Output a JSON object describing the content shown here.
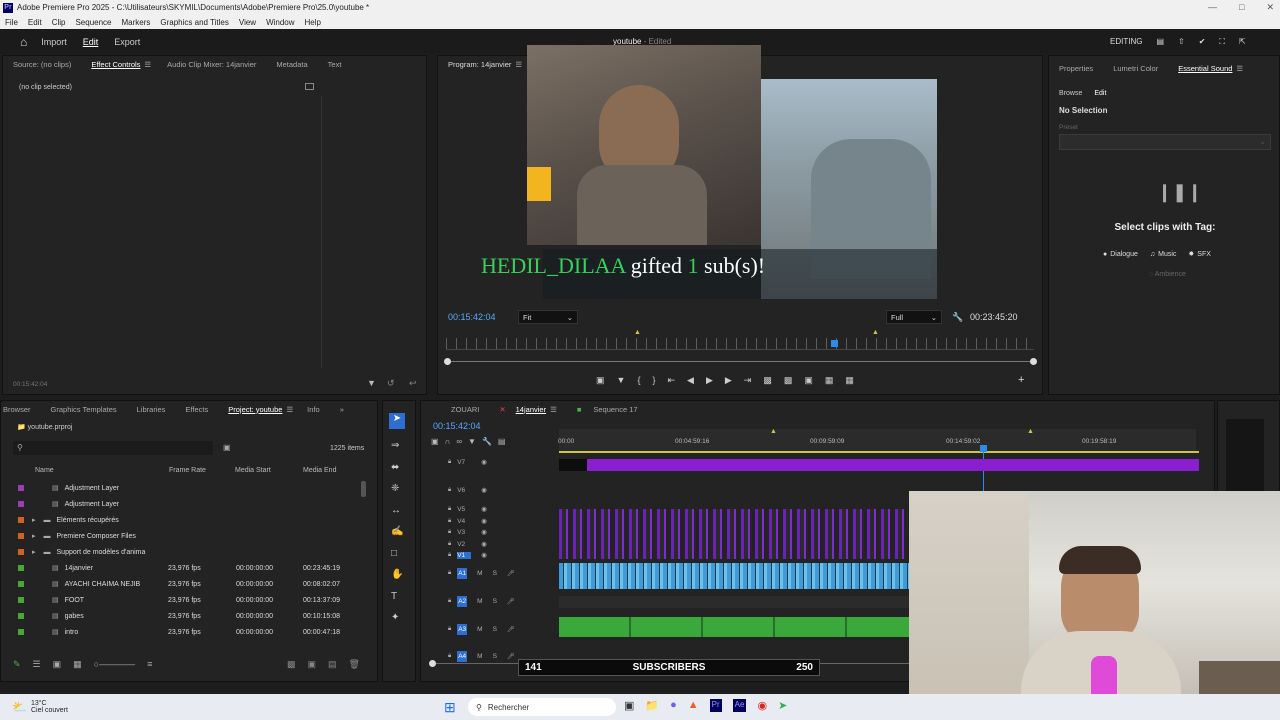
{
  "window": {
    "title": "Adobe Premiere Pro 2025 - C:\\Utilisateurs\\SKYMIL\\Documents\\Adobe\\Premiere Pro\\25.0\\youtube *",
    "app_badge": "Pr"
  },
  "menu": [
    "File",
    "Edit",
    "Clip",
    "Sequence",
    "Markers",
    "Graphics and Titles",
    "View",
    "Window",
    "Help"
  ],
  "header": {
    "nav": [
      "Import",
      "Edit",
      "Export"
    ],
    "active": "Edit",
    "project_title": "youtube",
    "project_status": " - Edited",
    "workspace": "EDITING"
  },
  "source_panel": {
    "tabs": [
      "Source: (no clips)",
      "Effect Controls",
      "Audio Clip Mixer: 14janvier",
      "Metadata",
      "Text"
    ],
    "active_tab": "Effect Controls",
    "empty_text": "(no clip selected)",
    "timecode": "00:15:42:04"
  },
  "program_panel": {
    "title": "Program: 14janvier",
    "overlay_name": "HEDIL_DILAA",
    "overlay_text": "gifted",
    "overlay_count": "1",
    "overlay_suffix": "sub(s)!",
    "timecode": "00:15:42:04",
    "fit": "Fit",
    "quality": "Full",
    "duration": "00:23:45:20",
    "playhead_fraction": 0.66
  },
  "essential_sound": {
    "tabs": [
      "Properties",
      "Lumetri Color",
      "Essential Sound"
    ],
    "active_tab": "Essential Sound",
    "subtabs": [
      "Browse",
      "Edit"
    ],
    "no_selection": "No Selection",
    "preset_label": "Preset",
    "select_title": "Select clips with Tag:",
    "tags": [
      "Dialogue",
      "Music",
      "SFX"
    ],
    "ambience": "Ambience"
  },
  "project_panel": {
    "tabs": [
      "Browser",
      "Graphics Templates",
      "Libraries",
      "Effects",
      "Project: youtube",
      "Info"
    ],
    "active_tab": "Project: youtube",
    "file": "youtube.prproj",
    "count": "1225 items",
    "columns": [
      "Name",
      "Frame Rate",
      "Media Start",
      "Media End"
    ],
    "rows": [
      {
        "name": "Adjustment Layer",
        "fps": "",
        "start": "",
        "end": "",
        "color": "#9b3fb0",
        "folder": false
      },
      {
        "name": "Adjustment Layer",
        "fps": "",
        "start": "",
        "end": "",
        "color": "#9b3fb0",
        "folder": false
      },
      {
        "name": "Eléments récupérés",
        "fps": "",
        "start": "",
        "end": "",
        "color": "#d0631f",
        "folder": true
      },
      {
        "name": "Premiere Composer Files",
        "fps": "",
        "start": "",
        "end": "",
        "color": "#d0631f",
        "folder": true
      },
      {
        "name": "Support de modèles d'anima",
        "fps": "",
        "start": "",
        "end": "",
        "color": "#d0631f",
        "folder": true
      },
      {
        "name": "14janvier",
        "fps": "23,976 fps",
        "start": "00:00:00:00",
        "end": "00:23:45:19",
        "color": "#4fa32f",
        "folder": false
      },
      {
        "name": "AYACHI CHAIMA NEJIB",
        "fps": "23,976 fps",
        "start": "00:00:00:00",
        "end": "00:08:02:07",
        "color": "#4fa32f",
        "folder": false
      },
      {
        "name": "FOOT",
        "fps": "23,976 fps",
        "start": "00:00:00:00",
        "end": "00:13:37:09",
        "color": "#4fa32f",
        "folder": false
      },
      {
        "name": "gabes",
        "fps": "23,976 fps",
        "start": "00:00:00:00",
        "end": "00:10:15:08",
        "color": "#4fa32f",
        "folder": false
      },
      {
        "name": "intro",
        "fps": "23,976 fps",
        "start": "00:00:00:00",
        "end": "00:00:47:18",
        "color": "#4fa32f",
        "folder": false
      }
    ]
  },
  "timeline": {
    "tabs": [
      "ZOUARI",
      "14janvier",
      "Sequence 17"
    ],
    "active_tab": "14janvier",
    "timecode": "00:15:42:04",
    "ruler": [
      "00:00",
      "00:04:59:16",
      "00:09:59:09",
      "00:14:59:02",
      "00:19:58:19"
    ],
    "video_tracks": [
      "V7",
      "V6",
      "V5",
      "V4",
      "V3",
      "V2",
      "V1"
    ],
    "audio_tracks": [
      "A1",
      "A2",
      "A3",
      "A4"
    ]
  },
  "subscribers": {
    "current": "141",
    "label": "SUBSCRIBERS",
    "goal": "250"
  },
  "taskbar": {
    "temp": "13°C",
    "weather": "Ciel couvert",
    "search": "Rechercher"
  },
  "colors": {
    "accent": "#2d8ceb",
    "clip_purple": "#8a1fd0",
    "clip_blue": "#3d9bd8",
    "clip_green": "#3aa83a",
    "overlay_green": "#39d05a"
  }
}
